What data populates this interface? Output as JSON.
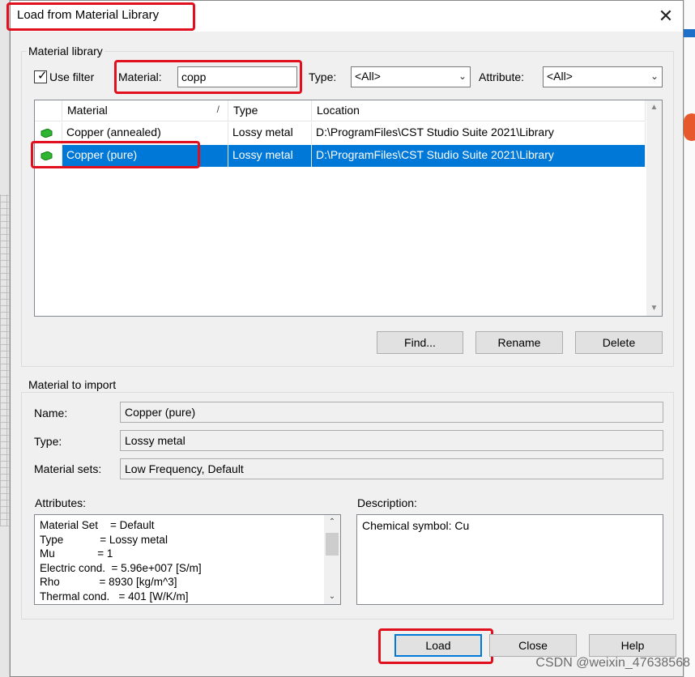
{
  "window": {
    "title": "Load from Material Library"
  },
  "library": {
    "group_label": "Material library",
    "use_filter_label": "Use filter",
    "use_filter_checked": true,
    "material_label": "Material:",
    "material_value": "copp",
    "type_label": "Type:",
    "type_value": "<All>",
    "attribute_label": "Attribute:",
    "attribute_value": "<All>",
    "columns": [
      "Material",
      "Type",
      "Location"
    ],
    "rows": [
      {
        "material": "Copper (annealed)",
        "type": "Lossy metal",
        "location": "D:\\ProgramFiles\\CST Studio Suite 2021\\Library",
        "selected": false
      },
      {
        "material": "Copper (pure)",
        "type": "Lossy metal",
        "location": "D:\\ProgramFiles\\CST Studio Suite 2021\\Library",
        "selected": true
      }
    ],
    "buttons": {
      "find": "Find...",
      "rename": "Rename",
      "delete": "Delete"
    }
  },
  "import": {
    "group_label": "Material to import",
    "name_label": "Name:",
    "name_value": "Copper (pure)",
    "type_label": "Type:",
    "type_value": "Lossy metal",
    "sets_label": "Material sets:",
    "sets_value": "Low Frequency, Default",
    "attributes_label": "Attributes:",
    "attributes": [
      "Material Set    = Default",
      "Type            = Lossy metal",
      "Mu              = 1",
      "Electric cond.  = 5.96e+007 [S/m]",
      "Rho             = 8930 [kg/m^3]",
      "Thermal cond.   = 401 [W/K/m]"
    ],
    "description_label": "Description:",
    "description_value": "Chemical symbol: Cu"
  },
  "footer": {
    "load": "Load",
    "close": "Close",
    "help": "Help"
  },
  "watermark": "CSDN @weixin_47638568",
  "colors": {
    "selection": "#0078d7",
    "highlight_box": "#e0101e",
    "material_icon": "#2fb52f"
  },
  "icons": [
    "close-icon",
    "material-icon",
    "sort-icon",
    "chevron-down-icon",
    "scroll-up-icon",
    "scroll-down-icon",
    "checkmark-icon"
  ]
}
